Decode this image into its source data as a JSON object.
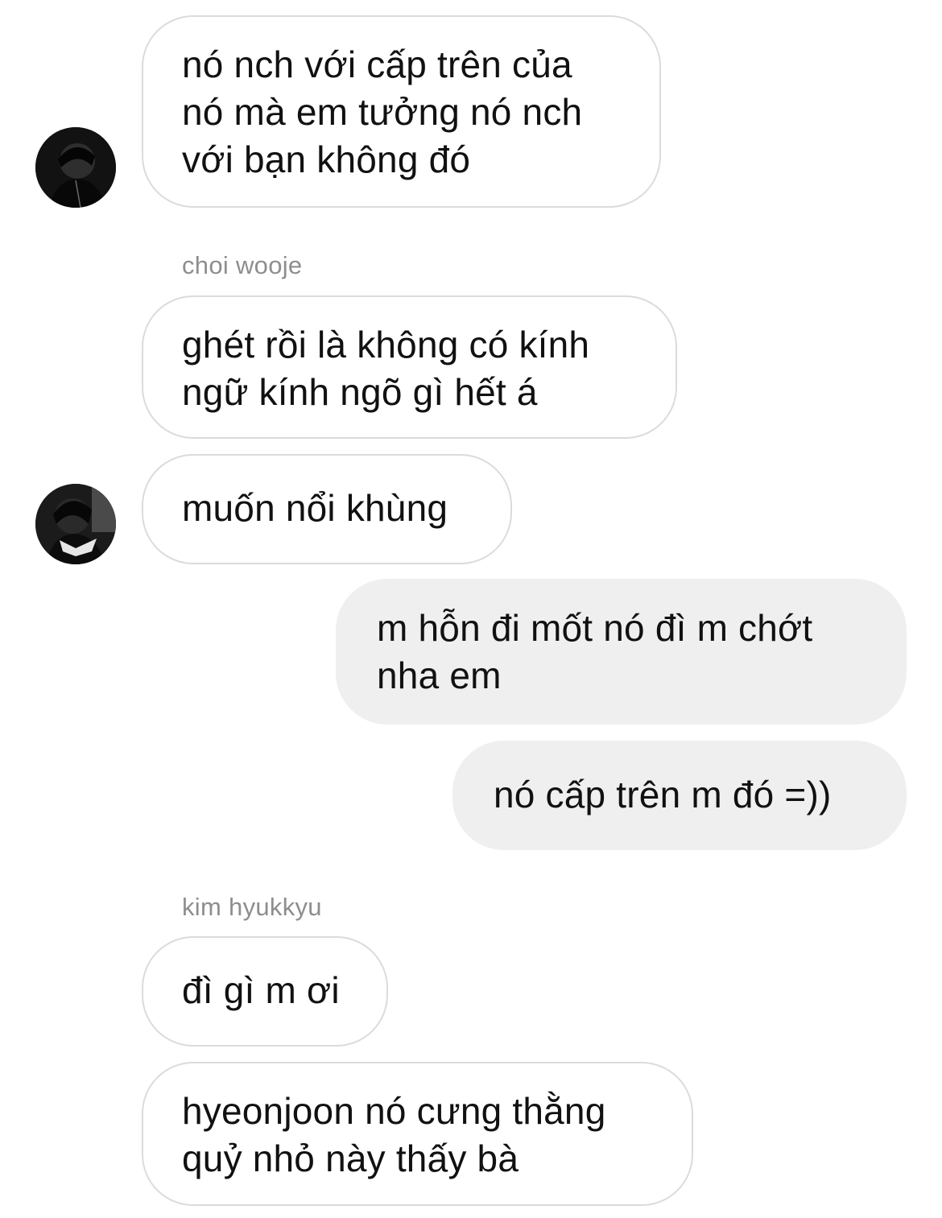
{
  "thread": {
    "messages": [
      {
        "id": "m1",
        "direction": "incoming",
        "sender": "",
        "text": "nó nch với cấp trên của\nnó mà em tưởng nó nch\nvới bạn không đó"
      },
      {
        "id": "m2",
        "direction": "incoming",
        "sender": "choi wooje",
        "text": "ghét rồi là không có kính\nngữ kính ngõ gì hết á"
      },
      {
        "id": "m3",
        "direction": "incoming",
        "sender": "",
        "text": "muốn nổi khùng"
      },
      {
        "id": "m4",
        "direction": "outgoing",
        "sender": "",
        "text": "m hỗn đi mốt nó đì m chớt\nnha em"
      },
      {
        "id": "m5",
        "direction": "outgoing",
        "sender": "",
        "text": "nó cấp trên m đó =))"
      },
      {
        "id": "m6",
        "direction": "incoming",
        "sender": "kim hyukkyu",
        "text": "đì gì m ơi"
      },
      {
        "id": "m7",
        "direction": "incoming",
        "sender": "",
        "text": "hyeonjoon nó cưng thằng\nquỷ nhỏ này thấy bà"
      }
    ],
    "senders": {
      "s1": "choi wooje",
      "s2": "kim hyukkyu"
    }
  },
  "colors": {
    "background": "#ffffff",
    "incoming_bubble_border": "#dbdbdb",
    "outgoing_bubble_fill": "#efefef",
    "sender_label": "#8e8e8e",
    "text": "#111111"
  },
  "icons": {
    "avatar": "profile-photo-avatar"
  }
}
